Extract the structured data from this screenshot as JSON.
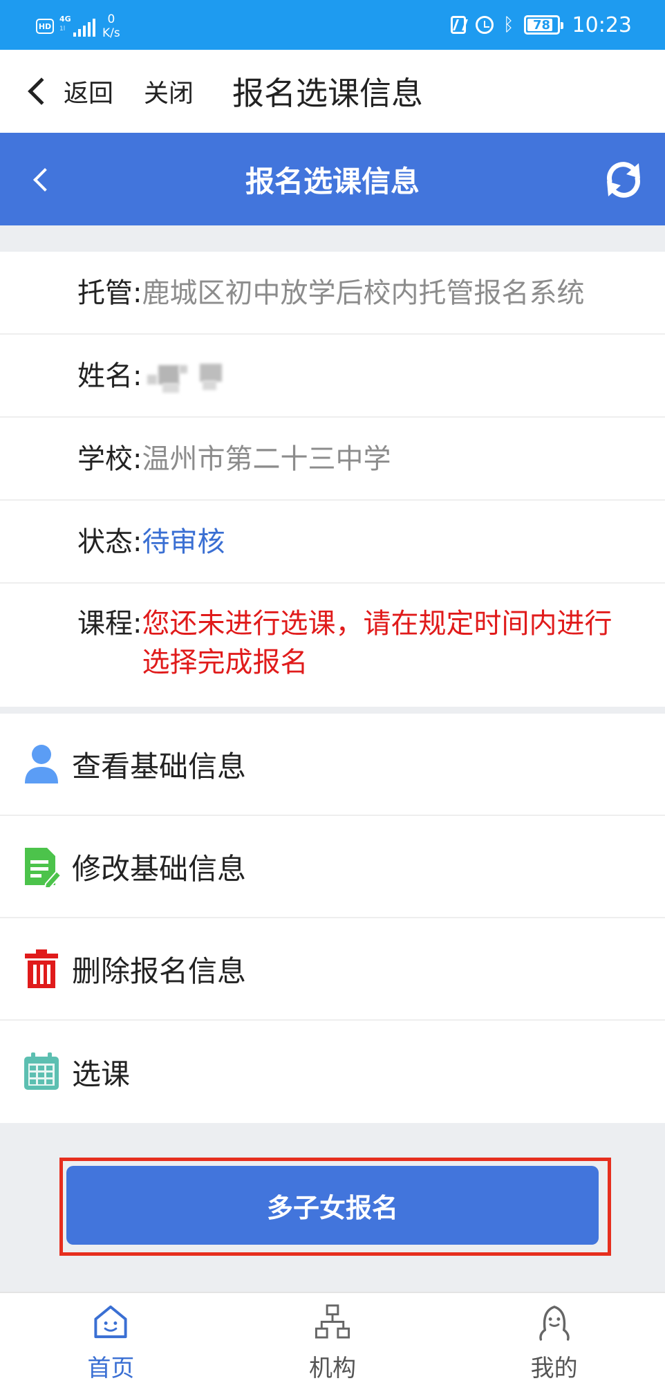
{
  "status_bar": {
    "hd_label": "HD",
    "network_label": "4G",
    "net_speed_value": "0",
    "net_speed_unit": "K/s",
    "battery_level": "78",
    "time": "10:23"
  },
  "webview_bar": {
    "back_label": "返回",
    "close_label": "关闭",
    "title": "报名选课信息"
  },
  "header": {
    "title": "报名选课信息",
    "accent_color": "#4275dc"
  },
  "info": {
    "tuoguan_label": "托管:",
    "tuoguan_value": "鹿城区初中放学后校内托管报名系统",
    "name_label": "姓名:",
    "school_label": "学校:",
    "school_value": "温州市第二十三中学",
    "status_label": "状态:",
    "status_value": "待审核",
    "status_color": "#3a6fd3",
    "course_label": "课程:",
    "course_value": "您还未进行选课，请在规定时间内进行选择完成报名",
    "course_color": "#e01b1b"
  },
  "actions": [
    {
      "icon": "person-icon",
      "label": "查看基础信息"
    },
    {
      "icon": "edit-document-icon",
      "label": "修改基础信息"
    },
    {
      "icon": "trash-icon",
      "label": "删除报名信息"
    },
    {
      "icon": "calendar-icon",
      "label": "选课"
    }
  ],
  "multi_child_button": {
    "label": "多子女报名",
    "highlight_color": "#e62e1e"
  },
  "bottom_nav": [
    {
      "icon": "home-icon",
      "label": "首页",
      "active": true
    },
    {
      "icon": "organization-icon",
      "label": "机构",
      "active": false
    },
    {
      "icon": "profile-icon",
      "label": "我的",
      "active": false
    }
  ]
}
